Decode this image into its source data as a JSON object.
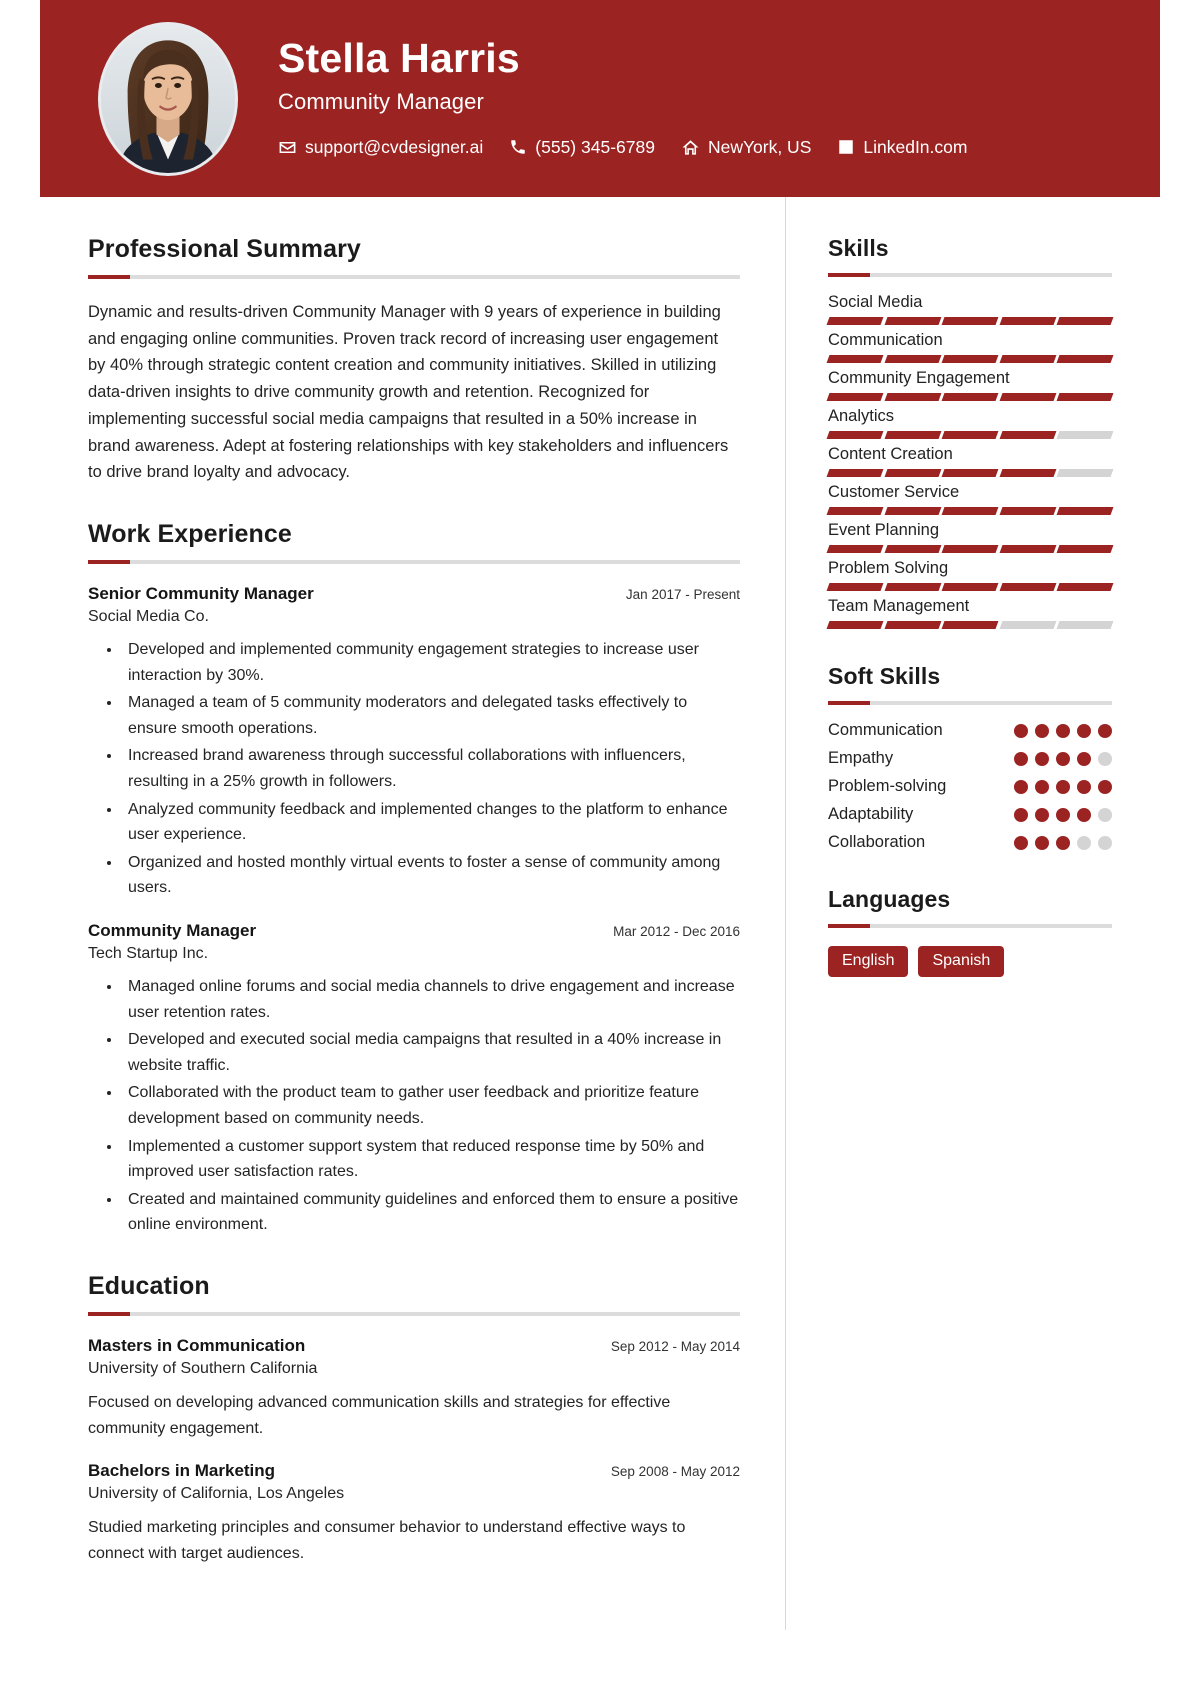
{
  "header": {
    "name": "Stella Harris",
    "role": "Community Manager",
    "avatar_alt": "profile-photo",
    "contacts": [
      {
        "icon": "envelope-icon",
        "text": "support@cvdesigner.ai"
      },
      {
        "icon": "phone-icon",
        "text": "(555) 345-6789"
      },
      {
        "icon": "home-icon",
        "text": "NewYork, US"
      },
      {
        "icon": "linkedin-icon",
        "text": "LinkedIn.com"
      }
    ],
    "background_color": "#9b2423"
  },
  "main": {
    "summary": {
      "title": "Professional Summary",
      "text": "Dynamic and results-driven Community Manager with 9 years of experience in building and engaging online communities. Proven track record of increasing user engagement by 40% through strategic content creation and community initiatives. Skilled in utilizing data-driven insights to drive community growth and retention. Recognized for implementing successful social media campaigns that resulted in a 50% increase in brand awareness. Adept at fostering relationships with key stakeholders and influencers to drive brand loyalty and advocacy."
    },
    "experience": {
      "title": "Work Experience",
      "entries": [
        {
          "position": "Senior Community Manager",
          "date": "Jan 2017 - Present",
          "company": "Social Media Co.",
          "bullets": [
            "Developed and implemented community engagement strategies to increase user interaction by 30%.",
            "Managed a team of 5 community moderators and delegated tasks effectively to ensure smooth operations.",
            "Increased brand awareness through successful collaborations with influencers, resulting in a 25% growth in followers.",
            "Analyzed community feedback and implemented changes to the platform to enhance user experience.",
            "Organized and hosted monthly virtual events to foster a sense of community among users."
          ]
        },
        {
          "position": "Community Manager",
          "date": "Mar 2012 - Dec 2016",
          "company": "Tech Startup Inc.",
          "bullets": [
            "Managed online forums and social media channels to drive engagement and increase user retention rates.",
            "Developed and executed social media campaigns that resulted in a 40% increase in website traffic.",
            "Collaborated with the product team to gather user feedback and prioritize feature development based on community needs.",
            "Implemented a customer support system that reduced response time by 50% and improved user satisfaction rates.",
            "Created and maintained community guidelines and enforced them to ensure a positive online environment."
          ]
        }
      ]
    },
    "education": {
      "title": "Education",
      "entries": [
        {
          "degree": "Masters in Communication",
          "date": "Sep 2012 - May 2014",
          "school": "University of Southern California",
          "description": "Focused on developing advanced communication skills and strategies for effective community engagement."
        },
        {
          "degree": "Bachelors in Marketing",
          "date": "Sep 2008 - May 2012",
          "school": "University of California, Los Angeles",
          "description": "Studied marketing principles and consumer behavior to understand effective ways to connect with target audiences."
        }
      ]
    }
  },
  "aside": {
    "skills": {
      "title": "Skills",
      "max": 5,
      "items": [
        {
          "name": "Social Media",
          "level": 5
        },
        {
          "name": "Communication",
          "level": 5
        },
        {
          "name": "Community Engagement",
          "level": 5
        },
        {
          "name": "Analytics",
          "level": 4
        },
        {
          "name": "Content Creation",
          "level": 4
        },
        {
          "name": "Customer Service",
          "level": 5
        },
        {
          "name": "Event Planning",
          "level": 5
        },
        {
          "name": "Problem Solving",
          "level": 5
        },
        {
          "name": "Team Management",
          "level": 3
        }
      ]
    },
    "soft_skills": {
      "title": "Soft Skills",
      "max": 5,
      "items": [
        {
          "name": "Communication",
          "level": 5
        },
        {
          "name": "Empathy",
          "level": 4
        },
        {
          "name": "Problem-solving",
          "level": 5
        },
        {
          "name": "Adaptability",
          "level": 4
        },
        {
          "name": "Collaboration",
          "level": 3
        }
      ]
    },
    "languages": {
      "title": "Languages",
      "items": [
        "English",
        "Spanish"
      ]
    }
  },
  "theme": {
    "accent": "#9b2423",
    "muted": "#d4d4d4",
    "text": "#242424"
  }
}
